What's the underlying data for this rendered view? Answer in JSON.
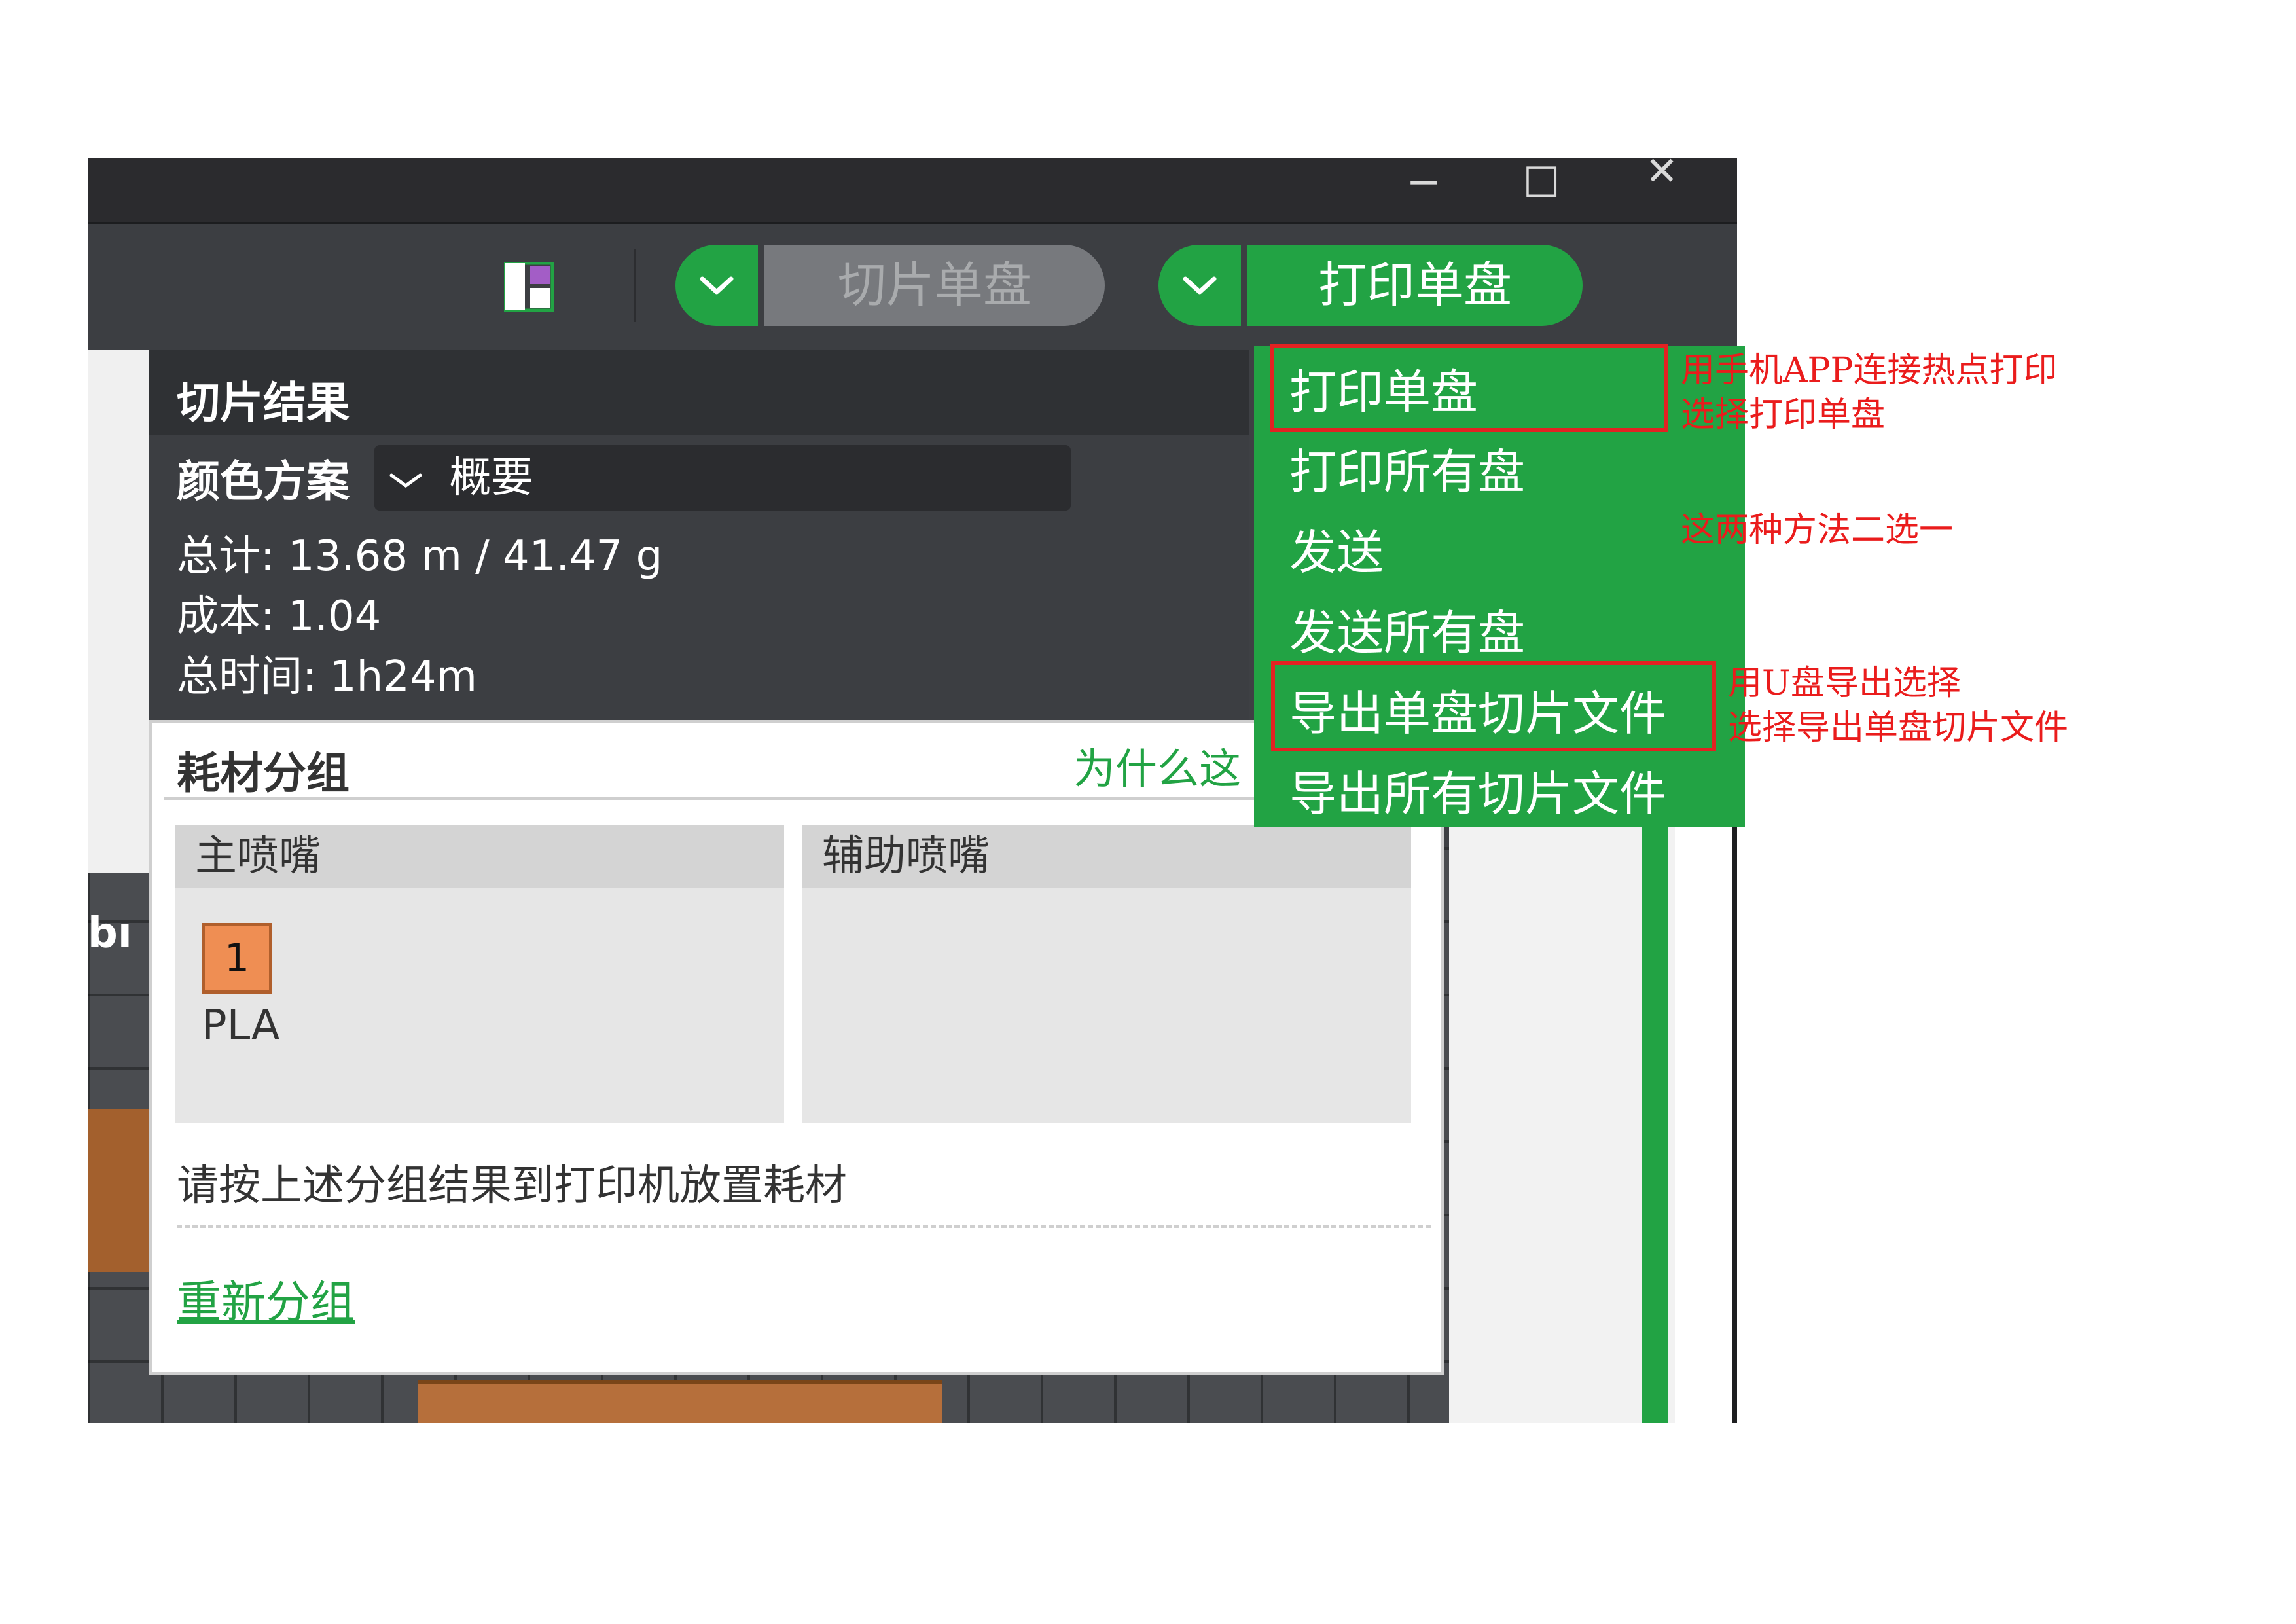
{
  "window": {
    "controls": {
      "minimize": "─",
      "maximize": "☐",
      "close": "✕"
    }
  },
  "toolbar": {
    "slice_button": "切片单盘",
    "print_button": "打印单盘",
    "dropdown_glyph": "﹀"
  },
  "slice_result": {
    "title": "切片结果",
    "color_scheme_label": "颜色方案",
    "color_scheme_value": "概要",
    "total": "总计:  13.68 m / 41.47 g",
    "cost": "成本:  1.04",
    "total_time": "总时间:  1h24m"
  },
  "filament_group": {
    "title": "耗材分组",
    "why_link": "为什么这",
    "main_nozzle": "主喷嘴",
    "aux_nozzle": "辅助喷嘴",
    "filament_index": "1",
    "filament_type": "PLA",
    "filament_color": "#ef8e53",
    "hint": "请按上述分组结果到打印机放置耗材",
    "regroup_link": "重新分组"
  },
  "print_menu": {
    "items": [
      "打印单盘",
      "打印所有盘",
      "发送",
      "发送所有盘",
      "导出单盘切片文件",
      "导出所有切片文件"
    ]
  },
  "annotations": {
    "note1_line1": "用手机APP连接热点打印",
    "note1_line2": "选择打印单盘",
    "note2": "这两种方法二选一",
    "note3_line1": "用U盘导出选择",
    "note3_line2": "选择导出单盘切片文件"
  },
  "colors": {
    "accent_green": "#22a344",
    "annotation_red": "#e32222"
  },
  "viewport_logo_fragment": "bı"
}
